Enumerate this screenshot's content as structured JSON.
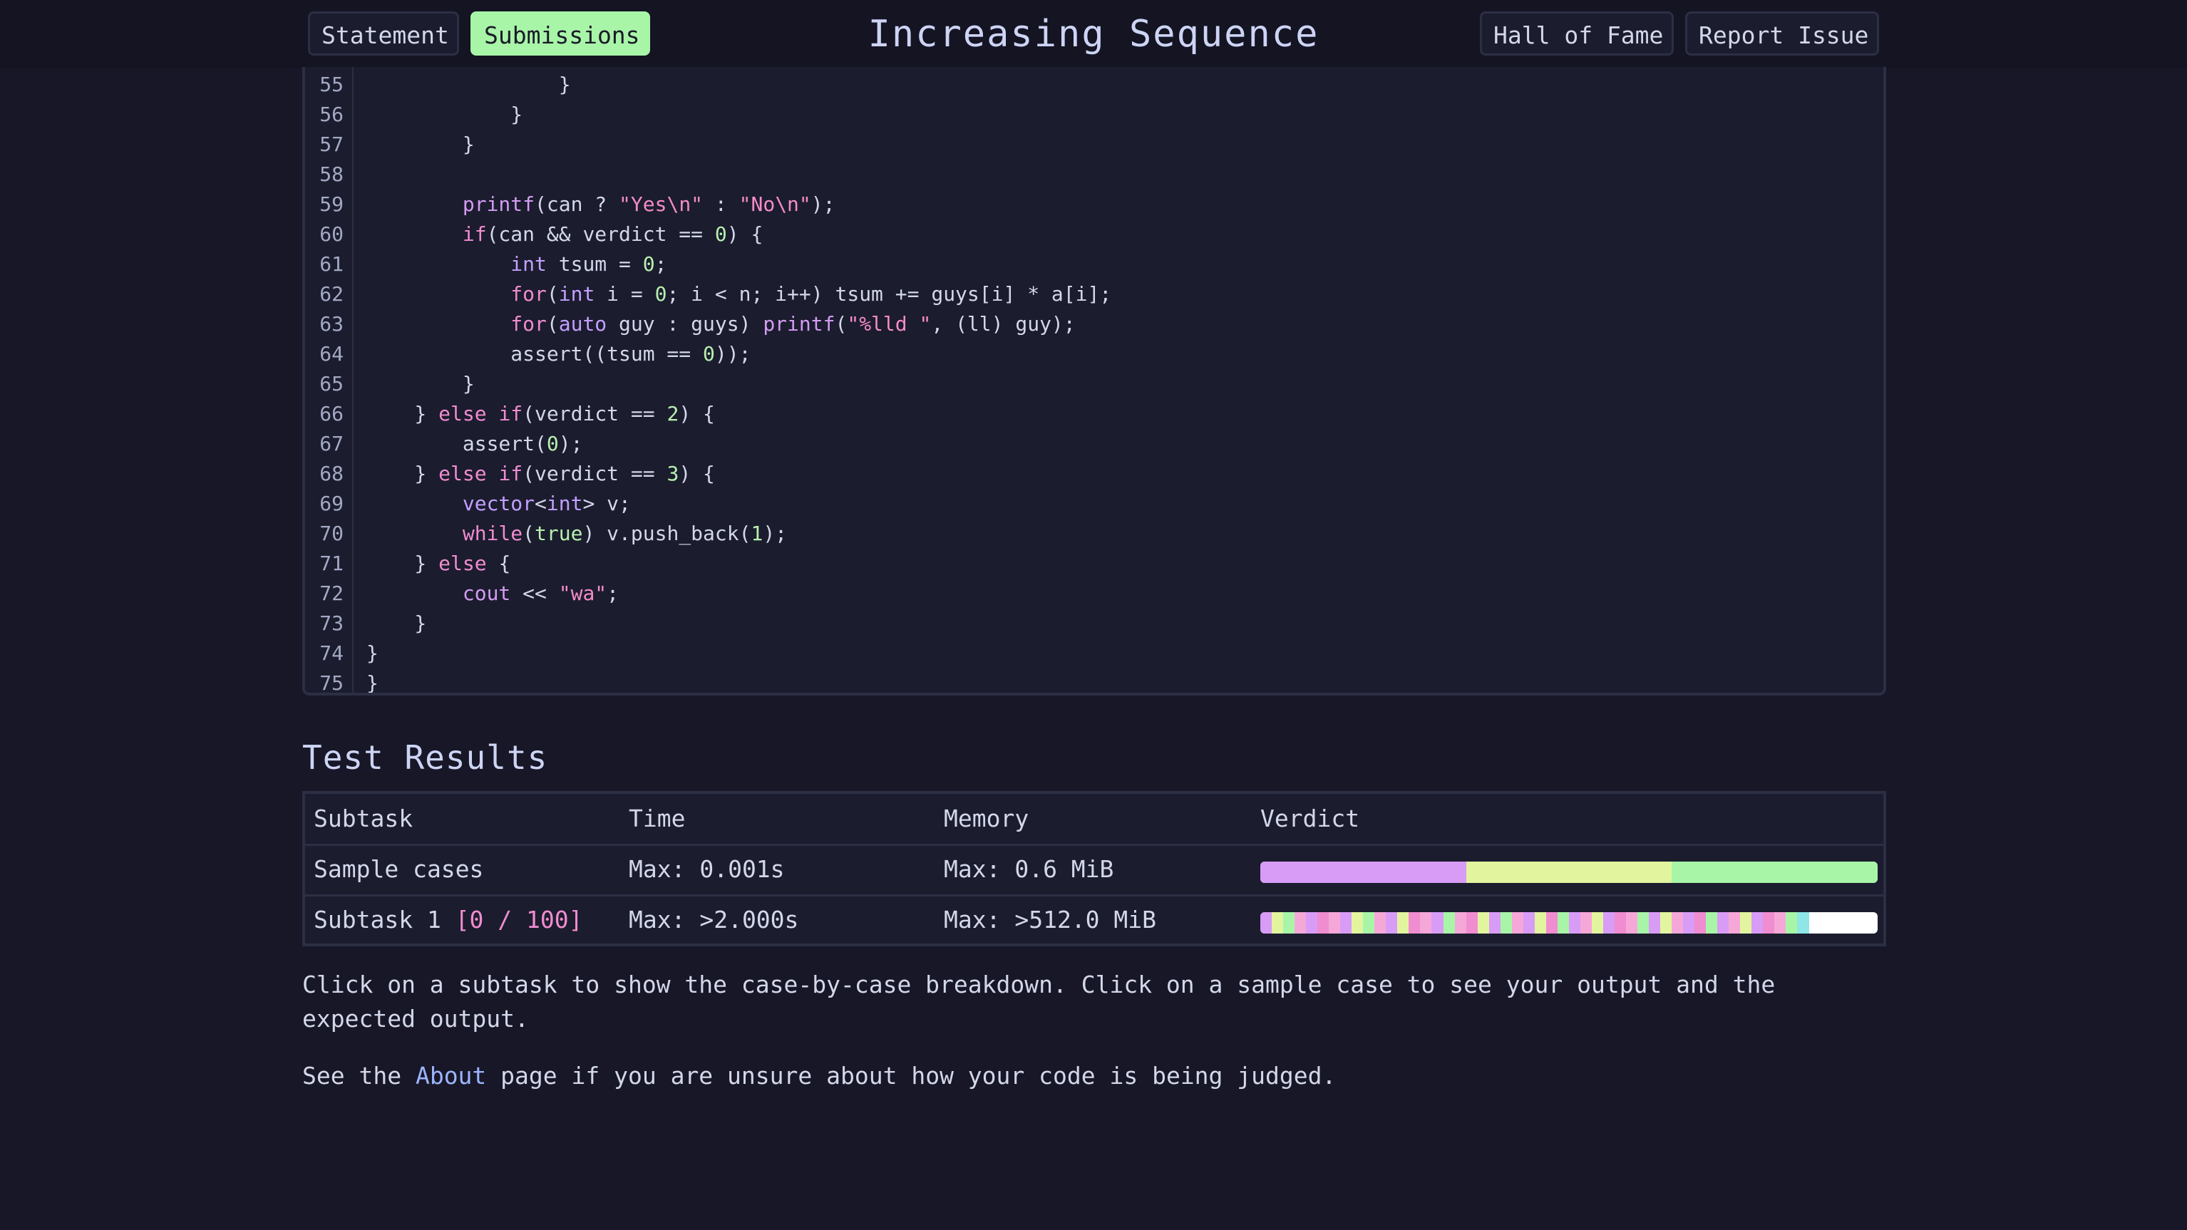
{
  "nav": {
    "statement": "Statement",
    "submissions": "Submissions",
    "hall_of_fame": "Hall of Fame",
    "report_issue": "Report Issue"
  },
  "title": "Increasing Sequence",
  "code": [
    {
      "n": "55",
      "t": [
        [
          "                }",
          ""
        ]
      ]
    },
    {
      "n": "56",
      "t": [
        [
          "            }",
          ""
        ]
      ]
    },
    {
      "n": "57",
      "t": [
        [
          "        }",
          ""
        ]
      ]
    },
    {
      "n": "58",
      "t": []
    },
    {
      "n": "59",
      "t": [
        [
          "        ",
          ""
        ],
        [
          "printf",
          "f"
        ],
        [
          "(can ? ",
          ""
        ],
        [
          "\"Yes\\n\"",
          "s"
        ],
        [
          " : ",
          ""
        ],
        [
          "\"No\\n\"",
          "s"
        ],
        [
          ");",
          ""
        ]
      ]
    },
    {
      "n": "60",
      "t": [
        [
          "        ",
          ""
        ],
        [
          "if",
          "k"
        ],
        [
          "(can && verdict == ",
          ""
        ],
        [
          "0",
          "n"
        ],
        [
          ") {",
          ""
        ]
      ]
    },
    {
      "n": "61",
      "t": [
        [
          "            ",
          ""
        ],
        [
          "int",
          "t"
        ],
        [
          " tsum = ",
          ""
        ],
        [
          "0",
          "n"
        ],
        [
          ";",
          ""
        ]
      ]
    },
    {
      "n": "62",
      "t": [
        [
          "            ",
          ""
        ],
        [
          "for",
          "k"
        ],
        [
          "(",
          ""
        ],
        [
          "int",
          "t"
        ],
        [
          " i = ",
          ""
        ],
        [
          "0",
          "n"
        ],
        [
          "; i < n; i++) tsum += guys[i] * a[i];",
          ""
        ]
      ]
    },
    {
      "n": "63",
      "t": [
        [
          "            ",
          ""
        ],
        [
          "for",
          "k"
        ],
        [
          "(",
          ""
        ],
        [
          "auto",
          "t"
        ],
        [
          " guy : guys) ",
          ""
        ],
        [
          "printf",
          "f"
        ],
        [
          "(",
          ""
        ],
        [
          "\"%lld \"",
          "s"
        ],
        [
          ", (ll) guy);",
          ""
        ]
      ]
    },
    {
      "n": "64",
      "t": [
        [
          "            assert((tsum == ",
          ""
        ],
        [
          "0",
          "n"
        ],
        [
          "));",
          ""
        ]
      ]
    },
    {
      "n": "65",
      "t": [
        [
          "        }",
          ""
        ]
      ]
    },
    {
      "n": "66",
      "t": [
        [
          "    } ",
          ""
        ],
        [
          "else",
          "k"
        ],
        [
          " ",
          ""
        ],
        [
          "if",
          "k"
        ],
        [
          "(verdict == ",
          ""
        ],
        [
          "2",
          "n"
        ],
        [
          ") {",
          ""
        ]
      ]
    },
    {
      "n": "67",
      "t": [
        [
          "        assert(",
          ""
        ],
        [
          "0",
          "n"
        ],
        [
          ");",
          ""
        ]
      ]
    },
    {
      "n": "68",
      "t": [
        [
          "    } ",
          ""
        ],
        [
          "else",
          "k"
        ],
        [
          " ",
          ""
        ],
        [
          "if",
          "k"
        ],
        [
          "(verdict == ",
          ""
        ],
        [
          "3",
          "n"
        ],
        [
          ") {",
          ""
        ]
      ]
    },
    {
      "n": "69",
      "t": [
        [
          "        ",
          ""
        ],
        [
          "vector",
          "t"
        ],
        [
          "<",
          ""
        ],
        [
          "int",
          "t"
        ],
        [
          "> v;",
          ""
        ]
      ]
    },
    {
      "n": "70",
      "t": [
        [
          "        ",
          ""
        ],
        [
          "while",
          "k"
        ],
        [
          "(",
          ""
        ],
        [
          "true",
          "n"
        ],
        [
          ") v.push_back(",
          ""
        ],
        [
          "1",
          "n"
        ],
        [
          ");",
          ""
        ]
      ]
    },
    {
      "n": "71",
      "t": [
        [
          "    } ",
          ""
        ],
        [
          "else",
          "k"
        ],
        [
          " {",
          ""
        ]
      ]
    },
    {
      "n": "72",
      "t": [
        [
          "        ",
          ""
        ],
        [
          "cout",
          "f"
        ],
        [
          " << ",
          ""
        ],
        [
          "\"wa\"",
          "s"
        ],
        [
          ";",
          ""
        ]
      ]
    },
    {
      "n": "73",
      "t": [
        [
          "    }",
          ""
        ]
      ]
    },
    {
      "n": "74",
      "t": [
        [
          "}",
          ""
        ]
      ]
    },
    {
      "n": "75",
      "t": [
        [
          "}",
          ""
        ]
      ]
    }
  ],
  "results": {
    "heading": "Test Results",
    "columns": [
      "Subtask",
      "Time",
      "Memory",
      "Verdict"
    ],
    "rows": [
      {
        "name": "Sample cases",
        "score": "",
        "time": "Max: 0.001s",
        "memory": "Max: 0.6 MiB",
        "bar": [
          "#d89cf6",
          "#e2f59e",
          "#a8f5a8"
        ]
      },
      {
        "name": "Subtask 1",
        "score": "[0 / 100]",
        "time": "Max: >2.000s",
        "memory": "Max: >512.0 MiB",
        "bar": [
          "#d89cf6",
          "#e2f59e",
          "#a8f5a8",
          "#f5a8d8",
          "#d89cf6",
          "#f08cd0",
          "#f5a8d8",
          "#d89cf6",
          "#e2f59e",
          "#a8f5a8",
          "#f5a8d8",
          "#d89cf6",
          "#e2f59e",
          "#f08cd0",
          "#f5a8d8",
          "#d89cf6",
          "#a8f5a8",
          "#f5a8d8",
          "#f08cd0",
          "#e2f59e",
          "#d89cf6",
          "#a8f5a8",
          "#f5a8d8",
          "#d89cf6",
          "#e2f59e",
          "#f08cd0",
          "#a8f5a8",
          "#d89cf6",
          "#f5a8d8",
          "#e2f59e",
          "#d89cf6",
          "#f08cd0",
          "#f5a8d8",
          "#a8f5a8",
          "#d89cf6",
          "#e2f59e",
          "#f5a8d8",
          "#d89cf6",
          "#f08cd0",
          "#a8f5a8",
          "#d89cf6",
          "#f5a8d8",
          "#e2f59e",
          "#d89cf6",
          "#f08cd0",
          "#f5a8d8",
          "#a8f5a8",
          "#8ee6e6"
        ]
      }
    ]
  },
  "notes": {
    "line1": "Click on a subtask to show the case-by-case breakdown. Click on a sample case to see your output and the",
    "line2": "expected output.",
    "about_prefix": "See the ",
    "about_link": "About",
    "about_suffix": " page if you are unsure about how your code is being judged."
  }
}
